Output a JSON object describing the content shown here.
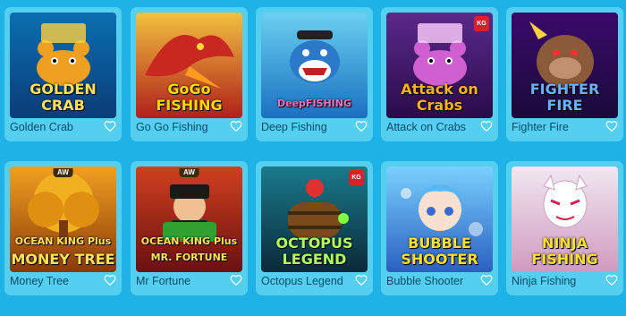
{
  "colors": {
    "page_bg": "#1fb2e6",
    "card_bg": "#54cff0",
    "title_text": "#0c4a6a",
    "heart": "#ffffff"
  },
  "games": [
    {
      "title": "Golden Crab",
      "logo_lines": [
        "GOLDEN",
        "CRAB"
      ],
      "badge": "",
      "provider_logo": "",
      "theme": "crab"
    },
    {
      "title": "Go Go Fishing",
      "logo_lines": [
        "GoGo",
        "FISHING"
      ],
      "badge": "",
      "provider_logo": "",
      "theme": "dragon"
    },
    {
      "title": "Deep Fishing",
      "logo_lines": [
        "DeepFISHING"
      ],
      "badge": "",
      "provider_logo": "",
      "theme": "shark"
    },
    {
      "title": "Attack on Crabs",
      "logo_lines": [
        "Attack on",
        "Crabs"
      ],
      "badge": "",
      "provider_logo": "KG",
      "theme": "purplecrab"
    },
    {
      "title": "Fighter Fire",
      "logo_lines": [
        "FIGHTER",
        "FIRE"
      ],
      "badge": "",
      "provider_logo": "",
      "theme": "gorilla"
    },
    {
      "title": "Money Tree",
      "logo_lines": [
        "OCEAN KING Plus",
        "MONEY TREE"
      ],
      "badge": "AW",
      "provider_logo": "",
      "theme": "tree"
    },
    {
      "title": "Mr Fortune",
      "logo_lines": [
        "OCEAN KING Plus",
        "MR. FORTUNE"
      ],
      "badge": "AW",
      "provider_logo": "",
      "theme": "fortune"
    },
    {
      "title": "Octopus Legend",
      "logo_lines": [
        "OCTOPUS",
        "LEGEND"
      ],
      "badge": "",
      "provider_logo": "KG",
      "theme": "octopus"
    },
    {
      "title": "Bubble Shooter",
      "logo_lines": [
        "BUBBLE",
        "SHOOTER"
      ],
      "badge": "",
      "provider_logo": "",
      "theme": "bubble"
    },
    {
      "title": "Ninja Fishing",
      "logo_lines": [
        "NINJA",
        "FISHING"
      ],
      "badge": "",
      "provider_logo": "",
      "theme": "ninja"
    }
  ]
}
